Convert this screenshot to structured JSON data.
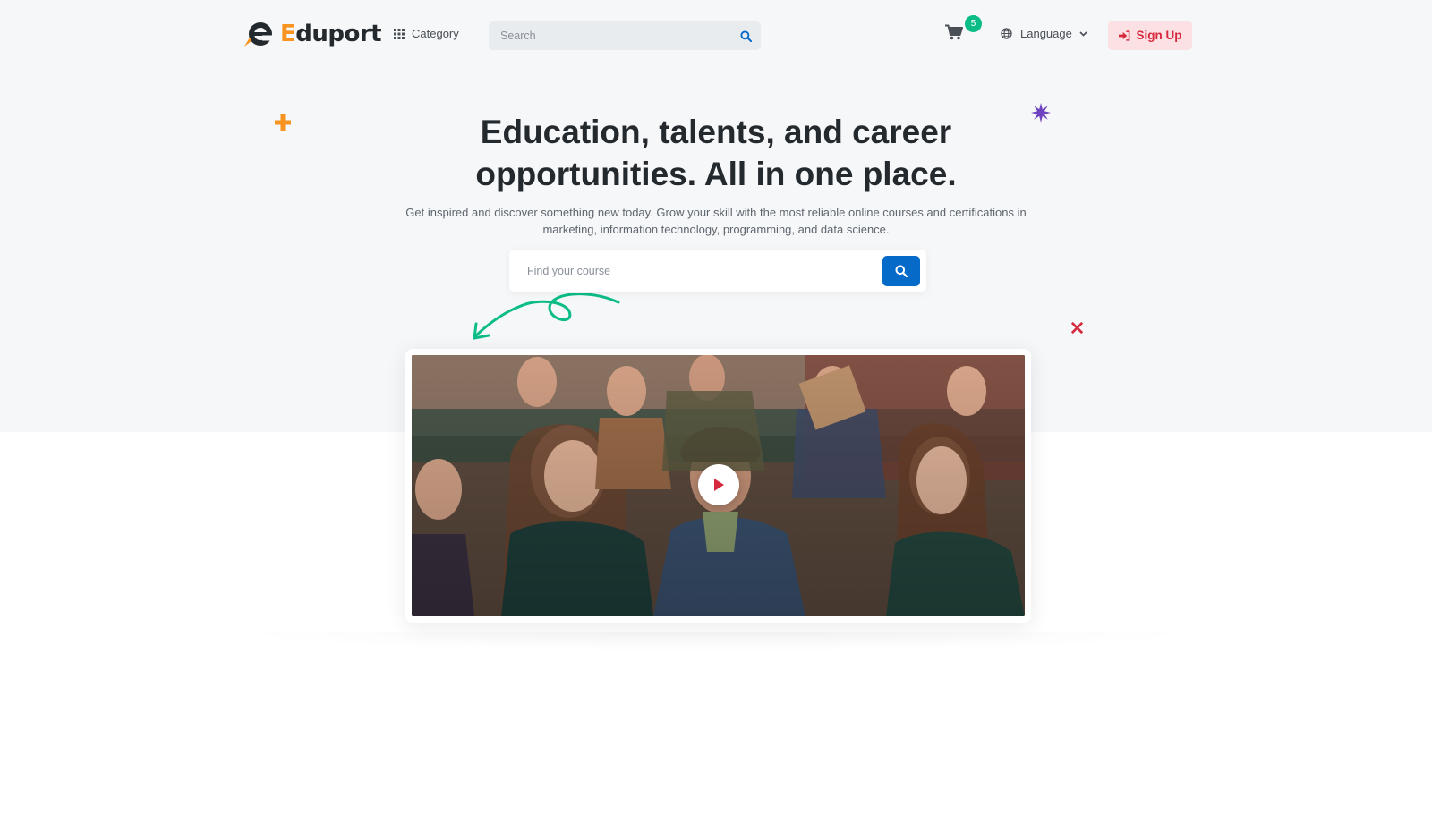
{
  "header": {
    "logo_text_accent": "E",
    "logo_text_rest": "duport",
    "category_label": "Category",
    "search_placeholder": "Search",
    "cart_count": "5",
    "language_label": "Language",
    "signup_label": "Sign Up"
  },
  "hero": {
    "title_line1": "Education, talents, and career",
    "title_line2": "opportunities. All in one place.",
    "subtitle_line1": "Get inspired and discover something new today. Grow your skill with the most reliable online courses and certifications in",
    "subtitle_line2": "marketing, information technology, programming, and data science.",
    "search_placeholder": "Find your course"
  },
  "icons": {
    "category": "grid-icon",
    "search": "search-icon",
    "cart": "cart-icon",
    "language": "globe-icon",
    "signup": "sign-in-icon",
    "play": "play-icon"
  },
  "colors": {
    "primary": "#066ac9",
    "accent_orange": "#f7931e",
    "success": "#0cbc87",
    "danger": "#d6293e",
    "purple": "#6f42c1",
    "hero_bg": "#f5f7f9"
  }
}
